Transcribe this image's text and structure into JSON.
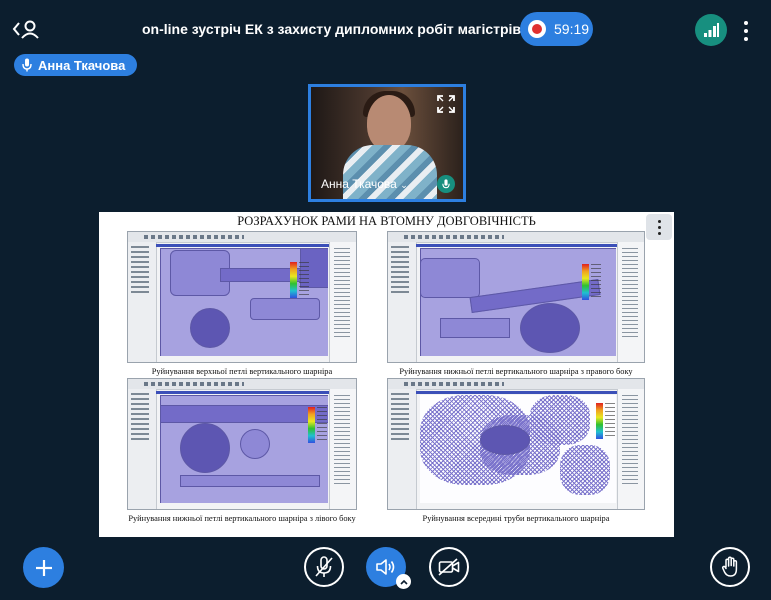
{
  "header": {
    "title": "on-line зустріч ЕК з захисту дипломних робіт магістрів...",
    "timer": "59:19",
    "back_icon": "back-user-icon",
    "more_icon": "more-vertical-icon",
    "connection_icon": "connection-status-icon"
  },
  "presenter_tag": {
    "name": "Анна Ткачова",
    "icon": "mic-icon"
  },
  "video": {
    "participant_name": "Анна Ткачова",
    "expand_icon": "fullscreen-icon",
    "mic_icon": "mic-icon"
  },
  "slide": {
    "title": "РОЗРАХУНОК РАМИ НА ВТОМНУ ДОВГОВІЧНІСТЬ",
    "captions": [
      "Руйнування верхньої петлі вертикального шарніра",
      "Руйнування нижньої петлі вертикального шарніра з правого боку",
      "Руйнування нижньої петлі вертикального шарніра з лівого боку",
      "Руйнування всередині труби вертикального шарніра"
    ],
    "menu_icon": "more-vertical-icon"
  },
  "controls": {
    "add_icon": "plus-icon",
    "mic_icon": "mic-muted-icon",
    "audio_icon": "speaker-icon",
    "camera_icon": "camera-off-icon",
    "hand_icon": "raise-hand-icon"
  },
  "colors": {
    "background": "#0c1e2e",
    "accent": "#2d7fe0",
    "connection": "#178f7f",
    "record": "#e03030"
  }
}
